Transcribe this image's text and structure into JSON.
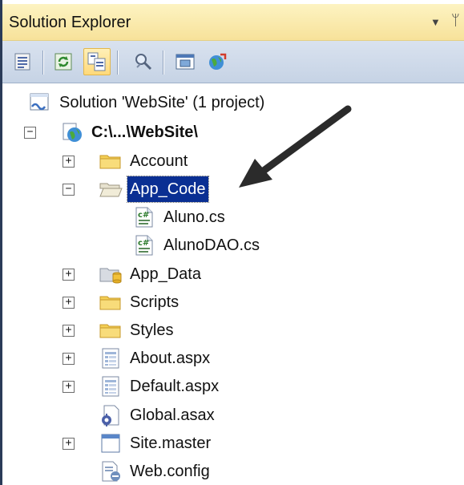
{
  "panel": {
    "title": "Solution Explorer",
    "dropdown_glyph": "▼",
    "pin_glyph": "ᛘ"
  },
  "toolbar": {
    "buttons": [
      {
        "name": "properties-icon"
      },
      {
        "name": "refresh-icon"
      },
      {
        "name": "show-all-files-icon",
        "active": true
      },
      {
        "name": "view-code-icon"
      },
      {
        "name": "view-designer-icon"
      },
      {
        "name": "copy-website-icon"
      }
    ]
  },
  "tree": {
    "solution": "Solution 'WebSite' (1 project)",
    "project": "C:\\...\\WebSite\\",
    "items": [
      {
        "label": "Account",
        "type": "folder",
        "expander": "+"
      },
      {
        "label": "App_Code",
        "type": "folder-open",
        "expander": "−",
        "selected": true
      },
      {
        "label": "Aluno.cs",
        "type": "cs-file",
        "child": true
      },
      {
        "label": "AlunoDAO.cs",
        "type": "cs-file",
        "child": true
      },
      {
        "label": "App_Data",
        "type": "folder-data",
        "expander": "+"
      },
      {
        "label": "Scripts",
        "type": "folder",
        "expander": "+"
      },
      {
        "label": "Styles",
        "type": "folder",
        "expander": "+"
      },
      {
        "label": "About.aspx",
        "type": "aspx-file",
        "expander": "+"
      },
      {
        "label": "Default.aspx",
        "type": "aspx-file",
        "expander": "+"
      },
      {
        "label": "Global.asax",
        "type": "asax-file"
      },
      {
        "label": "Site.master",
        "type": "master-file",
        "expander": "+"
      },
      {
        "label": "Web.config",
        "type": "config-file"
      }
    ]
  },
  "colors": {
    "selection": "#0a2f93",
    "folder": "#f4cf55",
    "arrow": "#2b2b2b"
  }
}
